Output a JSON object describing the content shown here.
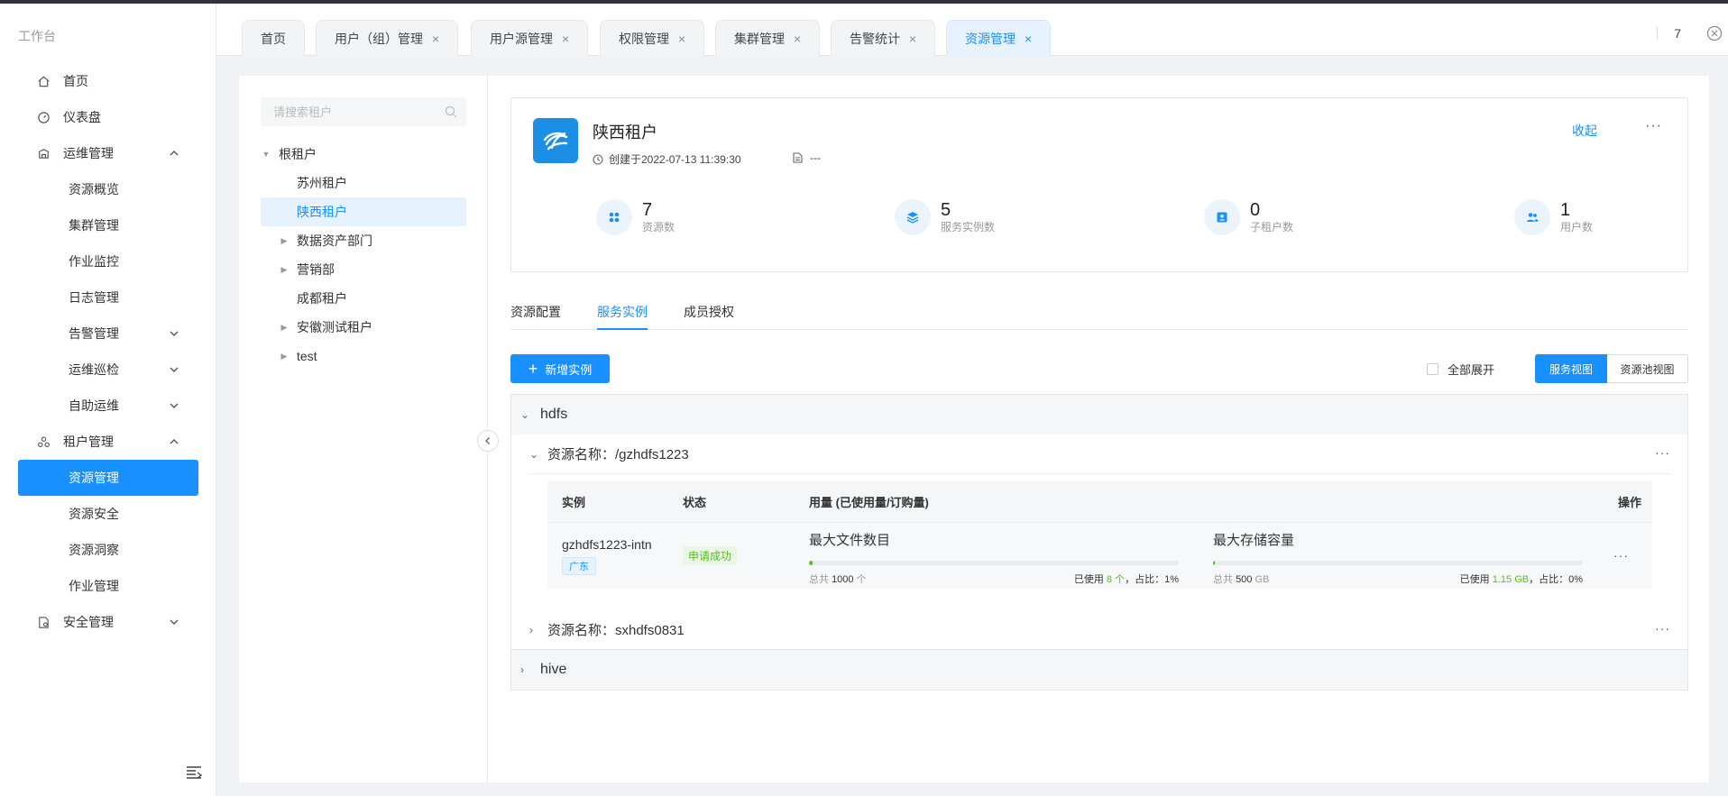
{
  "sidebar": {
    "brand": "工作台",
    "items": [
      {
        "label": "首页"
      },
      {
        "label": "仪表盘"
      },
      {
        "label": "运维管理"
      },
      {
        "label": "资源概览"
      },
      {
        "label": "集群管理"
      },
      {
        "label": "作业监控"
      },
      {
        "label": "日志管理"
      },
      {
        "label": "告警管理"
      },
      {
        "label": "运维巡检"
      },
      {
        "label": "自助运维"
      },
      {
        "label": "租户管理"
      },
      {
        "label": "资源管理"
      },
      {
        "label": "资源安全"
      },
      {
        "label": "资源洞察"
      },
      {
        "label": "作业管理"
      },
      {
        "label": "安全管理"
      }
    ]
  },
  "tabs": [
    {
      "label": "首页"
    },
    {
      "label": "用户（组）管理",
      "close": "×"
    },
    {
      "label": "用户源管理",
      "close": "×"
    },
    {
      "label": "权限管理",
      "close": "×"
    },
    {
      "label": "集群管理",
      "close": "×"
    },
    {
      "label": "告警统计",
      "close": "×"
    },
    {
      "label": "资源管理",
      "close": "×"
    }
  ],
  "tabbar_count": "7",
  "tree": {
    "search_placeholder": "请搜索租户",
    "nodes": [
      {
        "label": "根租户"
      },
      {
        "label": "苏州租户"
      },
      {
        "label": "陕西租户"
      },
      {
        "label": "数据资产部门"
      },
      {
        "label": "营销部"
      },
      {
        "label": "成都租户"
      },
      {
        "label": "安徽测试租户"
      },
      {
        "label": "test"
      }
    ]
  },
  "tenant": {
    "name": "陕西租户",
    "created": "创建于2022-07-13 11:39:30",
    "description": "---",
    "collapse_link": "收起",
    "more": "···",
    "stats": [
      {
        "value": "7",
        "caption": "资源数",
        "icon": "apps-icon"
      },
      {
        "value": "5",
        "caption": "服务实例数",
        "icon": "layers-icon"
      },
      {
        "value": "0",
        "caption": "子租户数",
        "icon": "id-card-icon"
      },
      {
        "value": "1",
        "caption": "用户数",
        "icon": "users-icon"
      }
    ]
  },
  "subtabs": [
    {
      "label": "资源配置"
    },
    {
      "label": "服务实例"
    },
    {
      "label": "成员授权"
    }
  ],
  "toolbar": {
    "add_label": "新增实例",
    "expand_all": "全部展开",
    "view_service": "服务视图",
    "view_pool": "资源池视图"
  },
  "groups": {
    "hdfs": {
      "name": "hdfs",
      "res1": "资源名称：/gzhdfs1223",
      "res2": "资源名称：sxhdfs0831",
      "table": {
        "headers": {
          "instance": "实例",
          "status": "状态",
          "usage": "用量 (已使用量/订购量)",
          "action": "操作"
        },
        "row": {
          "instance": "gzhdfs1223-intn",
          "region": "广东",
          "status": "申请成功",
          "files": {
            "title": "最大文件数目",
            "total_label": "总共",
            "total": "1000",
            "unit": "个",
            "used_label": "已使用",
            "used": "8 个",
            "ratio": "，占比：1%",
            "percent": 1
          },
          "storage": {
            "title": "最大存储容量",
            "total_label": "总共",
            "total": "500",
            "unit": "GB",
            "used_label": "已使用",
            "used": "1.15 GB",
            "ratio": "，占比：0%",
            "percent": 0
          }
        }
      }
    },
    "hive": {
      "name": "hive"
    }
  },
  "colors": {
    "accent": "#1890ff",
    "success": "#52c41a"
  }
}
